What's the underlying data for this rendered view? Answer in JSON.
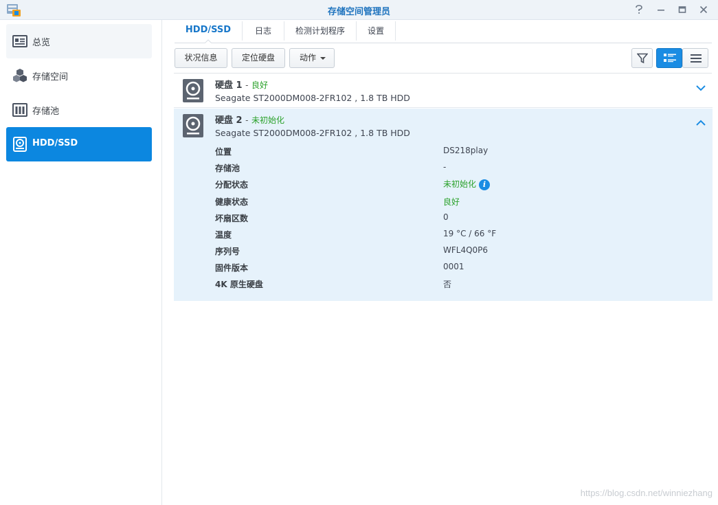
{
  "window": {
    "title": "存储空间管理员",
    "controls": {
      "help": "?",
      "minimize": "—",
      "maximize": "□",
      "close": "✕"
    }
  },
  "sidebar": {
    "items": [
      {
        "label": "总览",
        "icon": "overview-icon",
        "state": "hover"
      },
      {
        "label": "存储空间",
        "icon": "cubes-icon",
        "state": "normal"
      },
      {
        "label": "存储池",
        "icon": "storage-pool-icon",
        "state": "normal"
      },
      {
        "label": "HDD/SSD",
        "icon": "hdd-icon",
        "state": "active"
      }
    ]
  },
  "tabs": [
    {
      "label": "HDD/SSD",
      "active": true
    },
    {
      "label": "日志",
      "active": false
    },
    {
      "label": "检测计划程序",
      "active": false
    },
    {
      "label": "设置",
      "active": false
    }
  ],
  "toolbar": {
    "status_info": "状况信息",
    "locate_disk": "定位硬盘",
    "action": "动作",
    "filter_icon": "filter-icon",
    "detail_view_icon": "detail-list-icon",
    "list_view_icon": "list-icon"
  },
  "disks": [
    {
      "name": "硬盘 1",
      "separator": "-",
      "status": "良好",
      "model": "Seagate ST2000DM008-2FR102 , 1.8 TB HDD",
      "expanded": false
    },
    {
      "name": "硬盘 2",
      "separator": "-",
      "status": "未初始化",
      "model": "Seagate ST2000DM008-2FR102 , 1.8 TB HDD",
      "expanded": true,
      "details": [
        {
          "label": "位置",
          "value": "DS218play"
        },
        {
          "label": "存储池",
          "value": "-"
        },
        {
          "label": "分配状态",
          "value": "未初始化",
          "green": true,
          "info": true
        },
        {
          "label": "健康状态",
          "value": "良好",
          "green": true
        },
        {
          "label": "坏扇区数",
          "value": "0"
        },
        {
          "label": "温度",
          "value": "19 °C / 66 °F"
        },
        {
          "label": "序列号",
          "value": "WFL4Q0P6"
        },
        {
          "label": "固件版本",
          "value": "0001"
        },
        {
          "label": "4K 原生硬盘",
          "value": "否"
        }
      ]
    }
  ],
  "colors": {
    "accent": "#0c87e0",
    "status_good": "#2aa12a",
    "expanded_bg": "#e6f2fb"
  },
  "watermark": "https://blog.csdn.net/winniezhang"
}
